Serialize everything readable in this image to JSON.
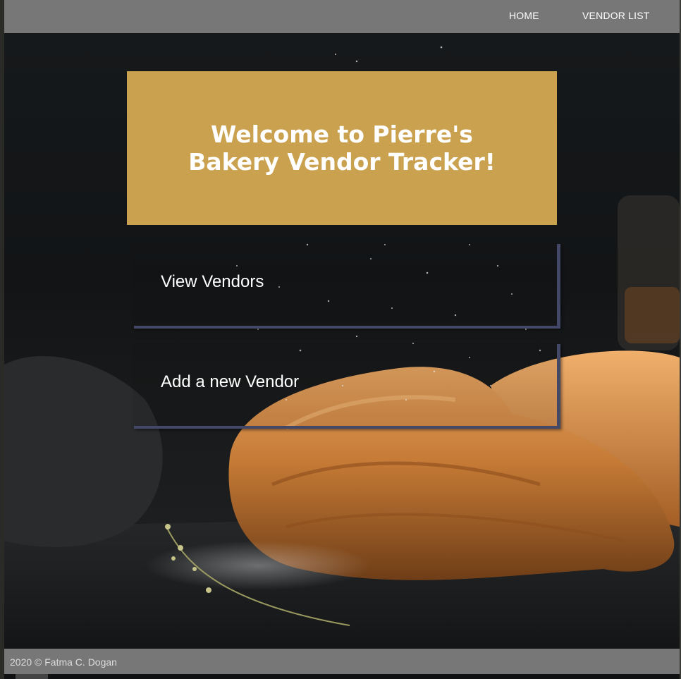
{
  "nav": {
    "home_label": "HOME",
    "vendor_list_label": "VENDOR LIST"
  },
  "hero": {
    "title": "Welcome to Pierre's Bakery Vendor Tracker!"
  },
  "cards": {
    "view_vendors_label": "View Vendors",
    "add_vendor_label": "Add a new Vendor"
  },
  "footer": {
    "text": "2020 © Fatma C. Dogan"
  },
  "colors": {
    "navbar": "#777777",
    "hero_background": "#c9a14f",
    "card_border": "#434866",
    "text": "#ffffff"
  },
  "background_image": "croissants dusted with flour on dark slate"
}
